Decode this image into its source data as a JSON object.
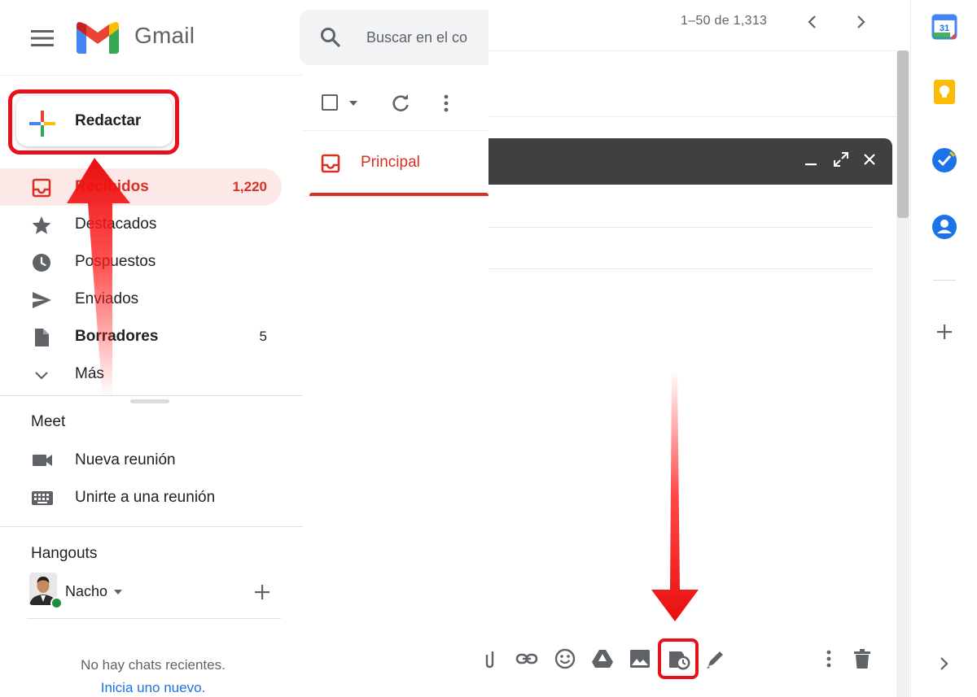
{
  "app": {
    "name": "Gmail",
    "search_placeholder": "Buscar en el co"
  },
  "compose": {
    "label": "Redactar"
  },
  "nav": {
    "items": [
      {
        "label": "Recibidos",
        "count": "1,220",
        "icon": "inbox-icon",
        "active": true
      },
      {
        "label": "Destacados",
        "count": "",
        "icon": "star-icon"
      },
      {
        "label": "Pospuestos",
        "count": "",
        "icon": "clock-icon"
      },
      {
        "label": "Enviados",
        "count": "",
        "icon": "send-icon"
      },
      {
        "label": "Borradores",
        "count": "5",
        "icon": "draft-icon",
        "bold": true
      },
      {
        "label": "Más",
        "count": "",
        "icon": "chevron-down-icon"
      }
    ]
  },
  "meet": {
    "title": "Meet",
    "new_meeting": "Nueva reunión",
    "join_meeting": "Unirte a una reunión"
  },
  "hangouts": {
    "title": "Hangouts",
    "user": "Nacho",
    "no_chats": "No hay chats recientes.",
    "start_new": "Inicia uno nuevo."
  },
  "tabs": {
    "principal": "Principal"
  },
  "pagination": {
    "range": "1–50 de 1,313"
  },
  "colors": {
    "accent_red": "#d93025",
    "highlight_red": "#e8101b",
    "compose_header": "#404040",
    "link_blue": "#1a73e8"
  },
  "compose_toolbar": {
    "icons": [
      "attach-icon",
      "link-icon",
      "emoji-icon",
      "drive-icon",
      "image-icon",
      "schedule-send-icon",
      "signature-icon",
      "more-options-icon",
      "delete-icon"
    ],
    "highlighted": "schedule-send-icon"
  },
  "side_panel": {
    "icons": [
      "calendar-icon",
      "keep-icon",
      "tasks-icon",
      "contacts-icon",
      "add-icon",
      "expand-icon"
    ],
    "calendar_day": "31"
  }
}
